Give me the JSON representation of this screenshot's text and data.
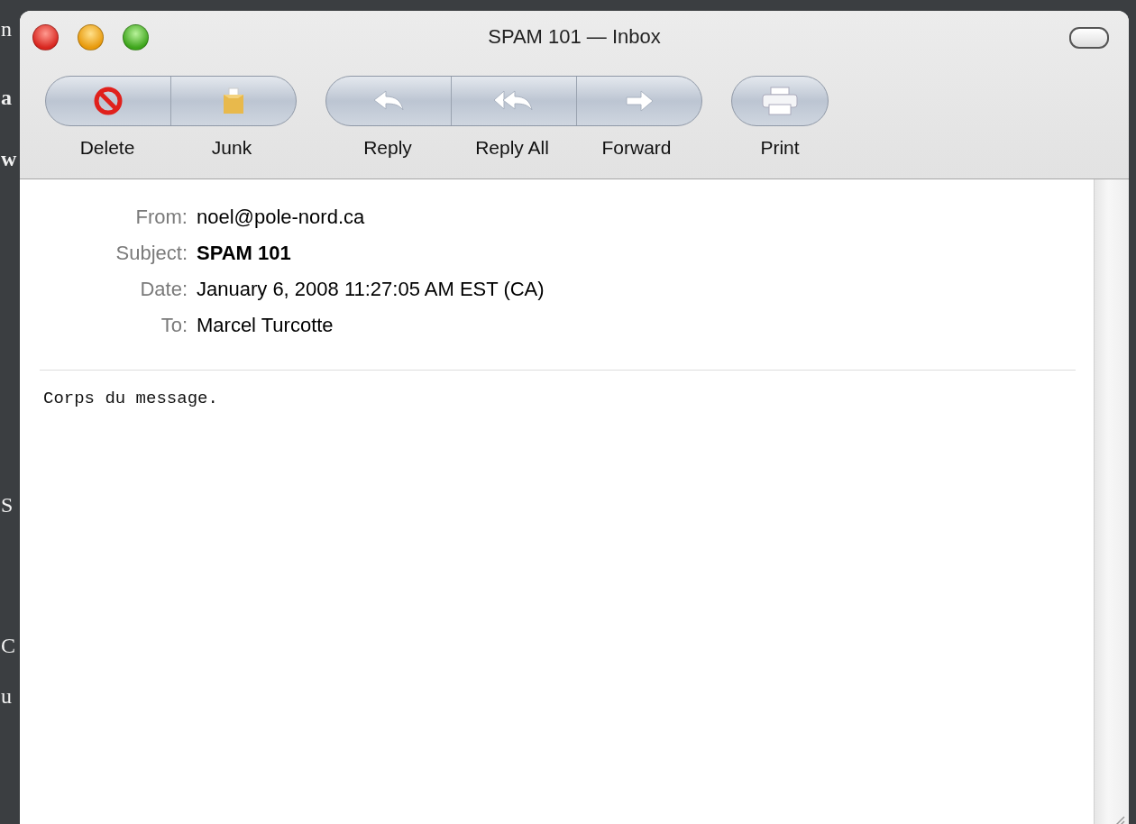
{
  "slide": {
    "fragments": [
      "n",
      "a",
      "w",
      "S",
      "C",
      "u"
    ]
  },
  "window": {
    "title": "SPAM 101 — Inbox"
  },
  "toolbar": [
    {
      "buttons": [
        {
          "label": "Delete"
        },
        {
          "label": "Junk"
        }
      ]
    },
    {
      "buttons": [
        {
          "label": "Reply"
        },
        {
          "label": "Reply All"
        },
        {
          "label": "Forward"
        }
      ]
    },
    {
      "buttons": [
        {
          "label": "Print"
        }
      ]
    }
  ],
  "headers": [
    {
      "label": "From:",
      "value": "noel@pole-nord.ca",
      "bold": false
    },
    {
      "label": "Subject:",
      "value": "SPAM 101",
      "bold": true
    },
    {
      "label": "Date:",
      "value": "January 6, 2008 11:27:05 AM EST (CA)",
      "bold": false
    },
    {
      "label": "To:",
      "value": "Marcel Turcotte",
      "bold": false
    }
  ],
  "body": "Corps du message."
}
